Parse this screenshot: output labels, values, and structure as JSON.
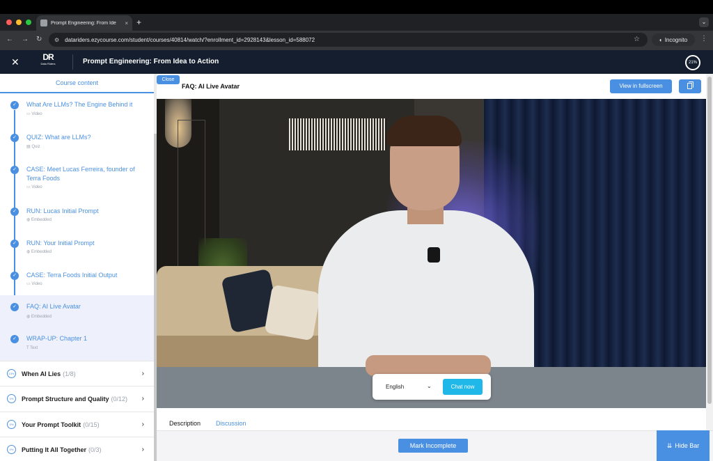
{
  "browser": {
    "tab_title": "Prompt Engineering: From Ide",
    "tab_close": "×",
    "new_tab": "+",
    "url": "datariders.ezycourse.com/student/courses/40814/watch/?enrollment_id=2928143&lesson_id=588072",
    "incognito_label": "Incognito",
    "colors": {
      "close": "#ff5f57",
      "min": "#febc2e",
      "max": "#28c840"
    }
  },
  "header": {
    "logo_mark": "DR",
    "logo_sub": "Data Riders",
    "course_title": "Prompt Engineering: From Idea to Action",
    "progress": "21%"
  },
  "sidebar": {
    "heading": "Course content",
    "lessons": [
      {
        "title": "What Are LLMs? The Engine Behind it",
        "type": "Video",
        "icon": "video-icon"
      },
      {
        "title": "QUIZ: What are LLMs?",
        "type": "Quiz",
        "icon": "quiz-icon"
      },
      {
        "title": "CASE: Meet Lucas Ferreira, founder of Terra Foods",
        "type": "Video",
        "icon": "video-icon"
      },
      {
        "title": "RUN: Lucas Initial Prompt",
        "type": "Embedded",
        "icon": "globe-icon"
      },
      {
        "title": "RUN: Your Initial Prompt",
        "type": "Embedded",
        "icon": "globe-icon"
      },
      {
        "title": "CASE: Terra Foods Initial Output",
        "type": "Video",
        "icon": "video-icon"
      },
      {
        "title": "FAQ: AI Live Avatar",
        "type": "Embedded",
        "icon": "globe-icon",
        "active": true
      },
      {
        "title": "WRAP-UP: Chapter 1",
        "type": "Text",
        "icon": "text-icon"
      }
    ],
    "chapters": [
      {
        "ring": "13%",
        "name": "When AI Lies",
        "count": "(1/8)"
      },
      {
        "ring": "0%",
        "name": "Prompt Structure and Quality",
        "count": "(0/12)"
      },
      {
        "ring": "0%",
        "name": "Your Prompt Toolkit",
        "count": "(0/15)"
      },
      {
        "ring": "0%",
        "name": "Putting It All Together",
        "count": "(0/3)"
      }
    ]
  },
  "main": {
    "close_label": "Close",
    "lesson_title": "FAQ: AI Live Avatar",
    "fullscreen_label": "View in fullscreen",
    "chat": {
      "language": "English",
      "button": "Chat now"
    },
    "tabs": [
      "Description",
      "Discussion"
    ],
    "mark_label": "Mark Incomplete",
    "hide_bar_label": "Hide Bar"
  }
}
